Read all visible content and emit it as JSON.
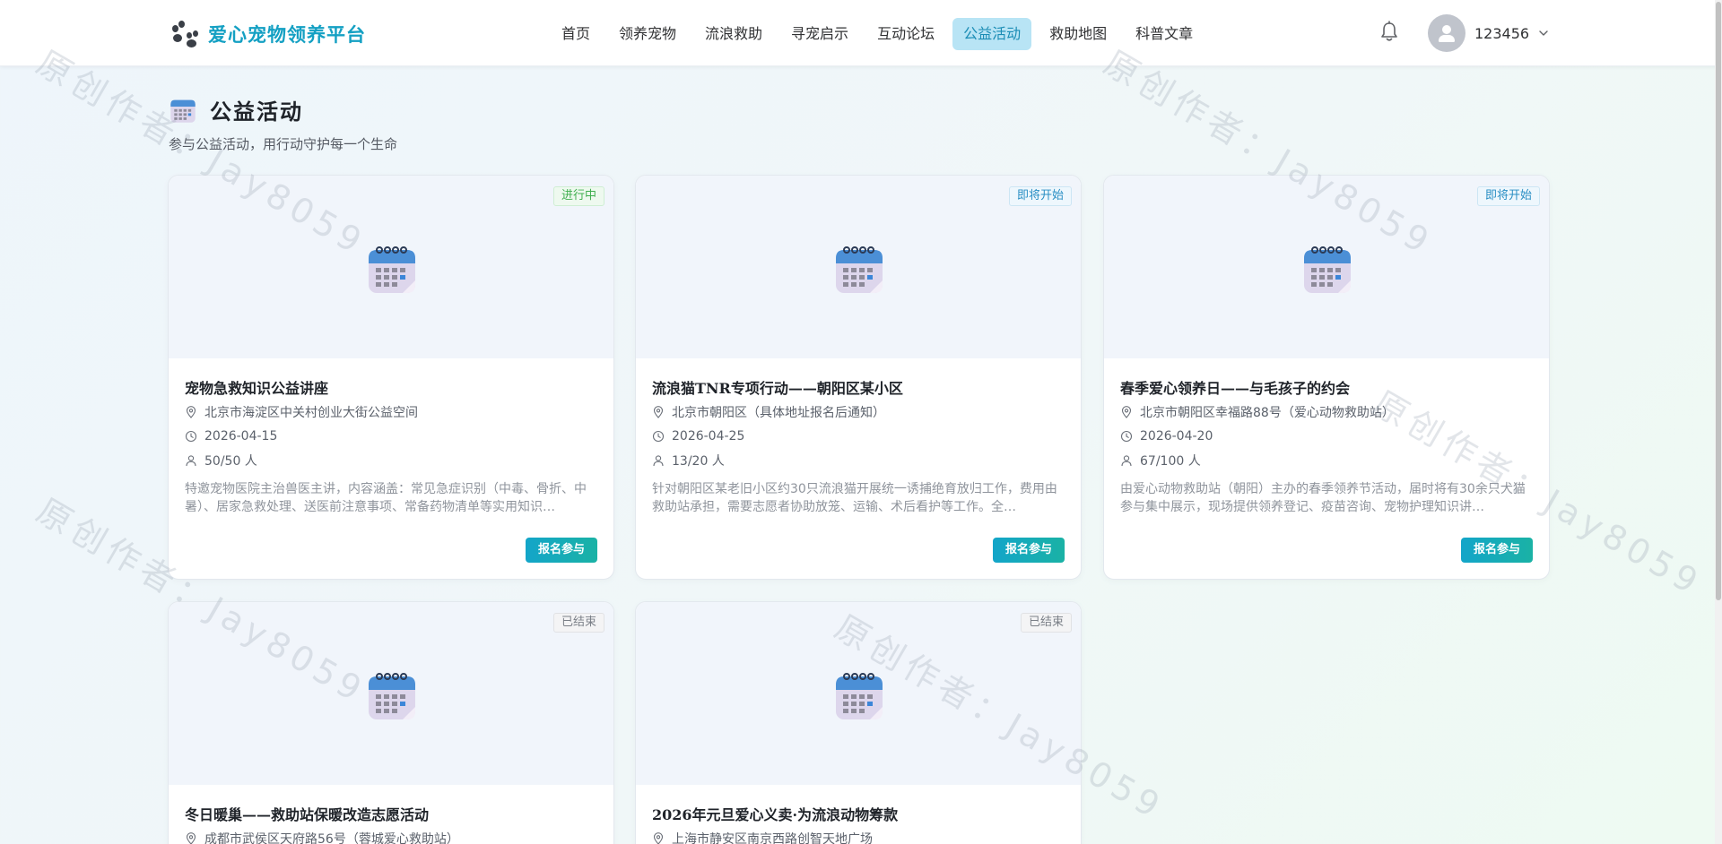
{
  "header": {
    "brand": "爱心宠物领养平台",
    "nav": [
      "首页",
      "领养宠物",
      "流浪救助",
      "寻宠启示",
      "互动论坛",
      "公益活动",
      "救助地图",
      "科普文章"
    ],
    "active_nav": "公益活动",
    "username": "123456"
  },
  "page": {
    "title": "公益活动",
    "subtitle": "参与公益活动，用行动守护每一个生命"
  },
  "watermark": "原创作者：Jay8059",
  "cards": [
    {
      "status": "进行中",
      "title": "宠物急救知识公益讲座",
      "location": "北京市海淀区中关村创业大街公益空间",
      "date": "2026-04-15",
      "participants": "50/50 人",
      "desc": "特邀宠物医院主治兽医主讲，内容涵盖：常见急症识别（中毒、骨折、中暑）、居家急救处理、送医前注意事项、常备药物清单等实用知识…",
      "button": "报名参与"
    },
    {
      "status": "即将开始",
      "title": "流浪猫TNR专项行动——朝阳区某小区",
      "location": "北京市朝阳区（具体地址报名后通知）",
      "date": "2026-04-25",
      "participants": "13/20 人",
      "desc": "针对朝阳区某老旧小区约30只流浪猫开展统一诱捕绝育放归工作，费用由救助站承担，需要志愿者协助放笼、运输、术后看护等工作。全…",
      "button": "报名参与"
    },
    {
      "status": "即将开始",
      "title": "春季爱心领养日——与毛孩子的约会",
      "location": "北京市朝阳区幸福路88号（爱心动物救助站）",
      "date": "2026-04-20",
      "participants": "67/100 人",
      "desc": "由爱心动物救助站（朝阳）主办的春季领养节活动，届时将有30余只犬猫参与集中展示，现场提供领养登记、疫苗咨询、宠物护理知识讲…",
      "button": "报名参与"
    },
    {
      "status": "已结束",
      "title": "冬日暖巢——救助站保暖改造志愿活动",
      "location": "成都市武侯区天府路56号（蓉城爱心救助站）"
    },
    {
      "status": "已结束",
      "title": "2026年元旦爱心义卖·为流浪动物筹款",
      "location": "上海市静安区南京西路创智天地广场"
    }
  ]
}
